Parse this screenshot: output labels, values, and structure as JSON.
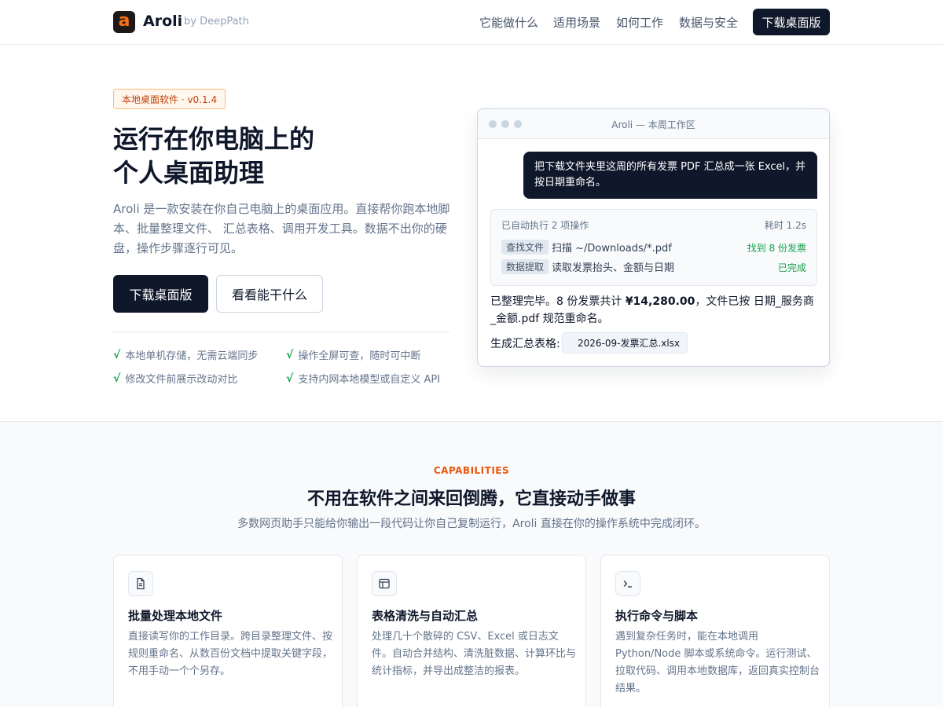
{
  "header": {
    "logo_letter": "a",
    "brand": "Aroli",
    "by": "by DeepPath",
    "nav": [
      "它能做什么",
      "适用场景",
      "如何工作",
      "数据与安全"
    ],
    "download": "下载桌面版"
  },
  "hero": {
    "badge": "本地桌面软件 · v0.1.4",
    "title_line1": "运行在你电脑上的",
    "title_line2": "个人桌面助理",
    "desc": "Aroli 是一款安装在你自己电脑上的桌面应用。直接帮你跑本地脚本、批量整理文件、 汇总表格、调用开发工具。数据不出你的硬盘，操作步骤逐行可见。",
    "primary": "下载桌面版",
    "secondary": "看看能干什么",
    "check": "√",
    "features": [
      "本地单机存储，无需云端同步",
      "操作全屏可查，随时可中断",
      "修改文件前展示改动对比",
      "支持内网本地模型或自定义 API"
    ]
  },
  "window": {
    "title": "Aroli — 本周工作区",
    "prompt": "把下载文件夹里这周的所有发票 PDF 汇总成一张 Excel，并按日期重命名。",
    "ops_summary": "已自动执行 2 项操作",
    "ops_time": "耗时 1.2s",
    "ops": [
      {
        "tag": "查找文件",
        "text": "扫描 ~/Downloads/*.pdf",
        "status": "找到 8 份发票"
      },
      {
        "tag": "数据提取",
        "text": "读取发票抬头、金额与日期",
        "status": "已完成"
      }
    ],
    "result_pre": "已整理完毕。8 份发票共计 ",
    "result_amount": "¥14,280.00",
    "result_post": "，文件已按 日期_服务商_金额.pdf 规范重命名。",
    "file_label": "生成汇总表格:",
    "file_name": "2026-09-发票汇总.xlsx"
  },
  "capabilities": {
    "eyebrow": "CAPABILITIES",
    "title": "不用在软件之间来回倒腾，它直接动手做事",
    "subtitle": "多数网页助手只能给你输出一段代码让你自己复制运行，Aroli 直接在你的操作系统中完成闭环。",
    "cards": [
      {
        "icon": "document-icon",
        "title": "批量处理本地文件",
        "desc": "直接读写你的工作目录。跨目录整理文件、按规则重命名、从数百份文档中提取关键字段，不用手动一个个另存。"
      },
      {
        "icon": "table-icon",
        "title": "表格清洗与自动汇总",
        "desc": "处理几十个散碎的 CSV、Excel 或日志文件。自动合并结构、清洗脏数据、计算环比与统计指标，并导出成整洁的报表。"
      },
      {
        "icon": "terminal-icon",
        "title": "执行命令与脚本",
        "desc": "遇到复杂任务时，能在本地调用 Python/Node 脚本或系统命令。运行测试、拉取代码、调用本地数据库，返回真实控制台结果。"
      }
    ]
  }
}
